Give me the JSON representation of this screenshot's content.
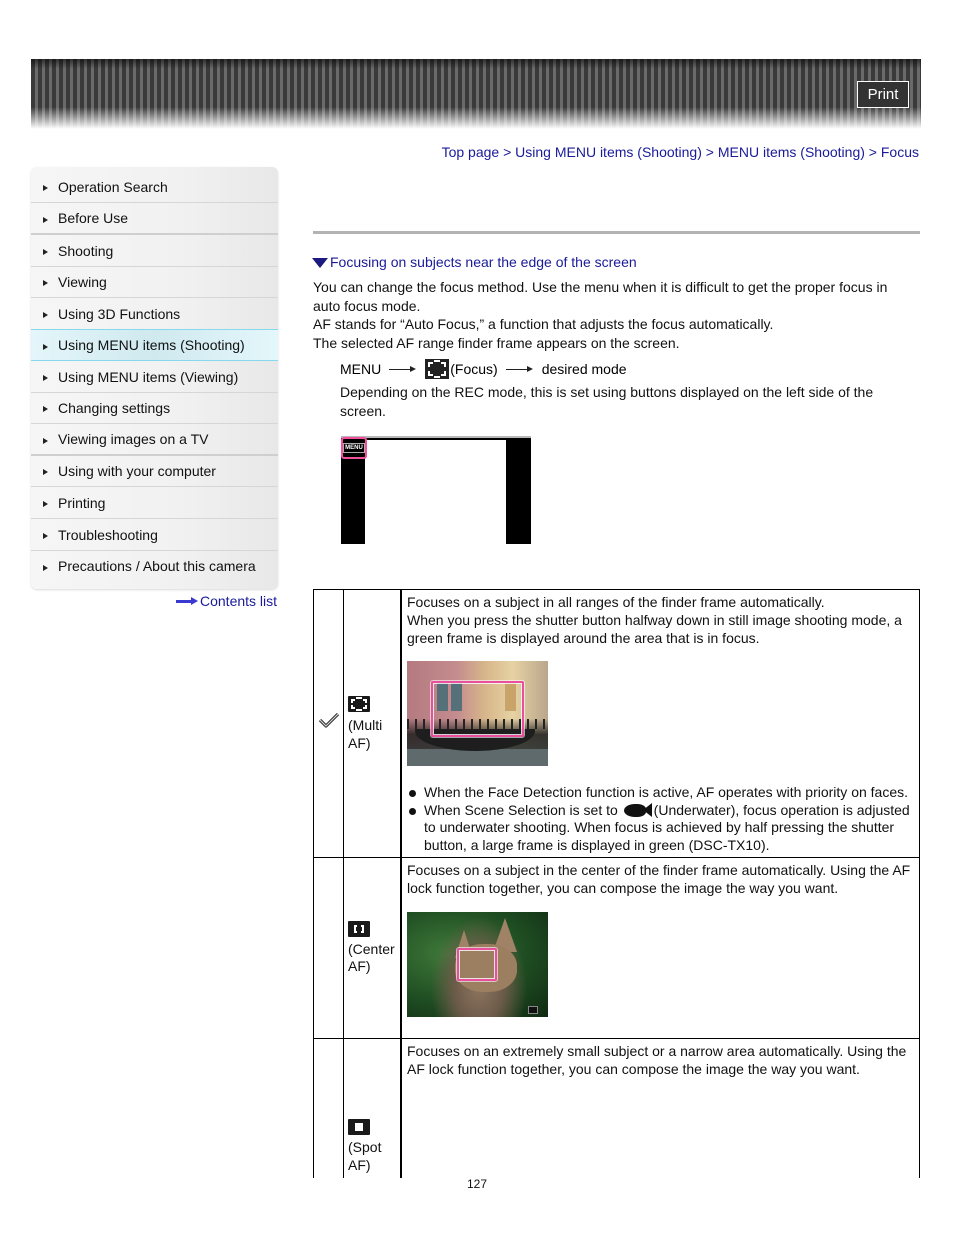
{
  "header": {
    "print_label": "Print"
  },
  "breadcrumb": {
    "items": [
      "Top page",
      "Using MENU items (Shooting)",
      "MENU items (Shooting)",
      "Focus"
    ],
    "separator": ">"
  },
  "sidebar": {
    "items": [
      {
        "label": "Operation Search"
      },
      {
        "label": "Before Use"
      },
      {
        "label": "Shooting"
      },
      {
        "label": "Viewing"
      },
      {
        "label": "Using 3D Functions"
      },
      {
        "label": "Using MENU items (Shooting)",
        "active": true
      },
      {
        "label": "Using MENU items (Viewing)"
      },
      {
        "label": "Changing settings"
      },
      {
        "label": "Viewing images on a TV"
      },
      {
        "label": "Using with your computer"
      },
      {
        "label": "Printing"
      },
      {
        "label": "Troubleshooting"
      },
      {
        "label": "Precautions / About this camera"
      }
    ],
    "contents_link": "Contents list"
  },
  "main": {
    "section_link": "Focusing on subjects near the edge of the screen",
    "intro": [
      "You can change the focus method. Use the menu when it is difficult to get the proper focus in auto focus mode.",
      "AF stands for “Auto Focus,” a function that adjusts the focus automatically.",
      "The selected AF range finder frame appears on the screen."
    ],
    "menu_path": {
      "step1": "MENU",
      "step2": "(Focus)",
      "step3": "desired mode"
    },
    "menu_note": "Depending on the REC mode, this is set using buttons displayed on the left side of the screen.",
    "screen_menu_button": "MENU"
  },
  "table": {
    "rows": [
      {
        "default": true,
        "mode_label_1": "(Multi",
        "mode_label_2": "AF)",
        "description": "Focuses on a subject in all ranges of the finder frame automatically.",
        "description_2": "When you press the shutter button halfway down in still image shooting mode, a green frame is displayed around the area that is in focus.",
        "bullets": [
          "When the Face Detection function is active, AF operates with priority on faces.",
          {
            "before": "When Scene Selection is set to",
            "after": "(Underwater), focus operation is adjusted to underwater shooting. When focus is achieved by half pressing the shutter button, a large frame is displayed in green (DSC-TX10)."
          }
        ]
      },
      {
        "mode_label_1": "(Center",
        "mode_label_2": "AF)",
        "description": "Focuses on a subject in the center of the finder frame automatically. Using the AF lock function together, you can compose the image the way you want."
      },
      {
        "mode_label_1": "(Spot",
        "mode_label_2": "AF)",
        "description": "Focuses on an extremely small subject or a narrow area automatically. Using the AF lock function together, you can compose the image the way you want."
      }
    ]
  },
  "footer": {
    "page_number": "127"
  },
  "colors": {
    "link": "#1a1a99",
    "active_nav_border": "#86d9ec",
    "af_frame": "#ea4f9e"
  }
}
